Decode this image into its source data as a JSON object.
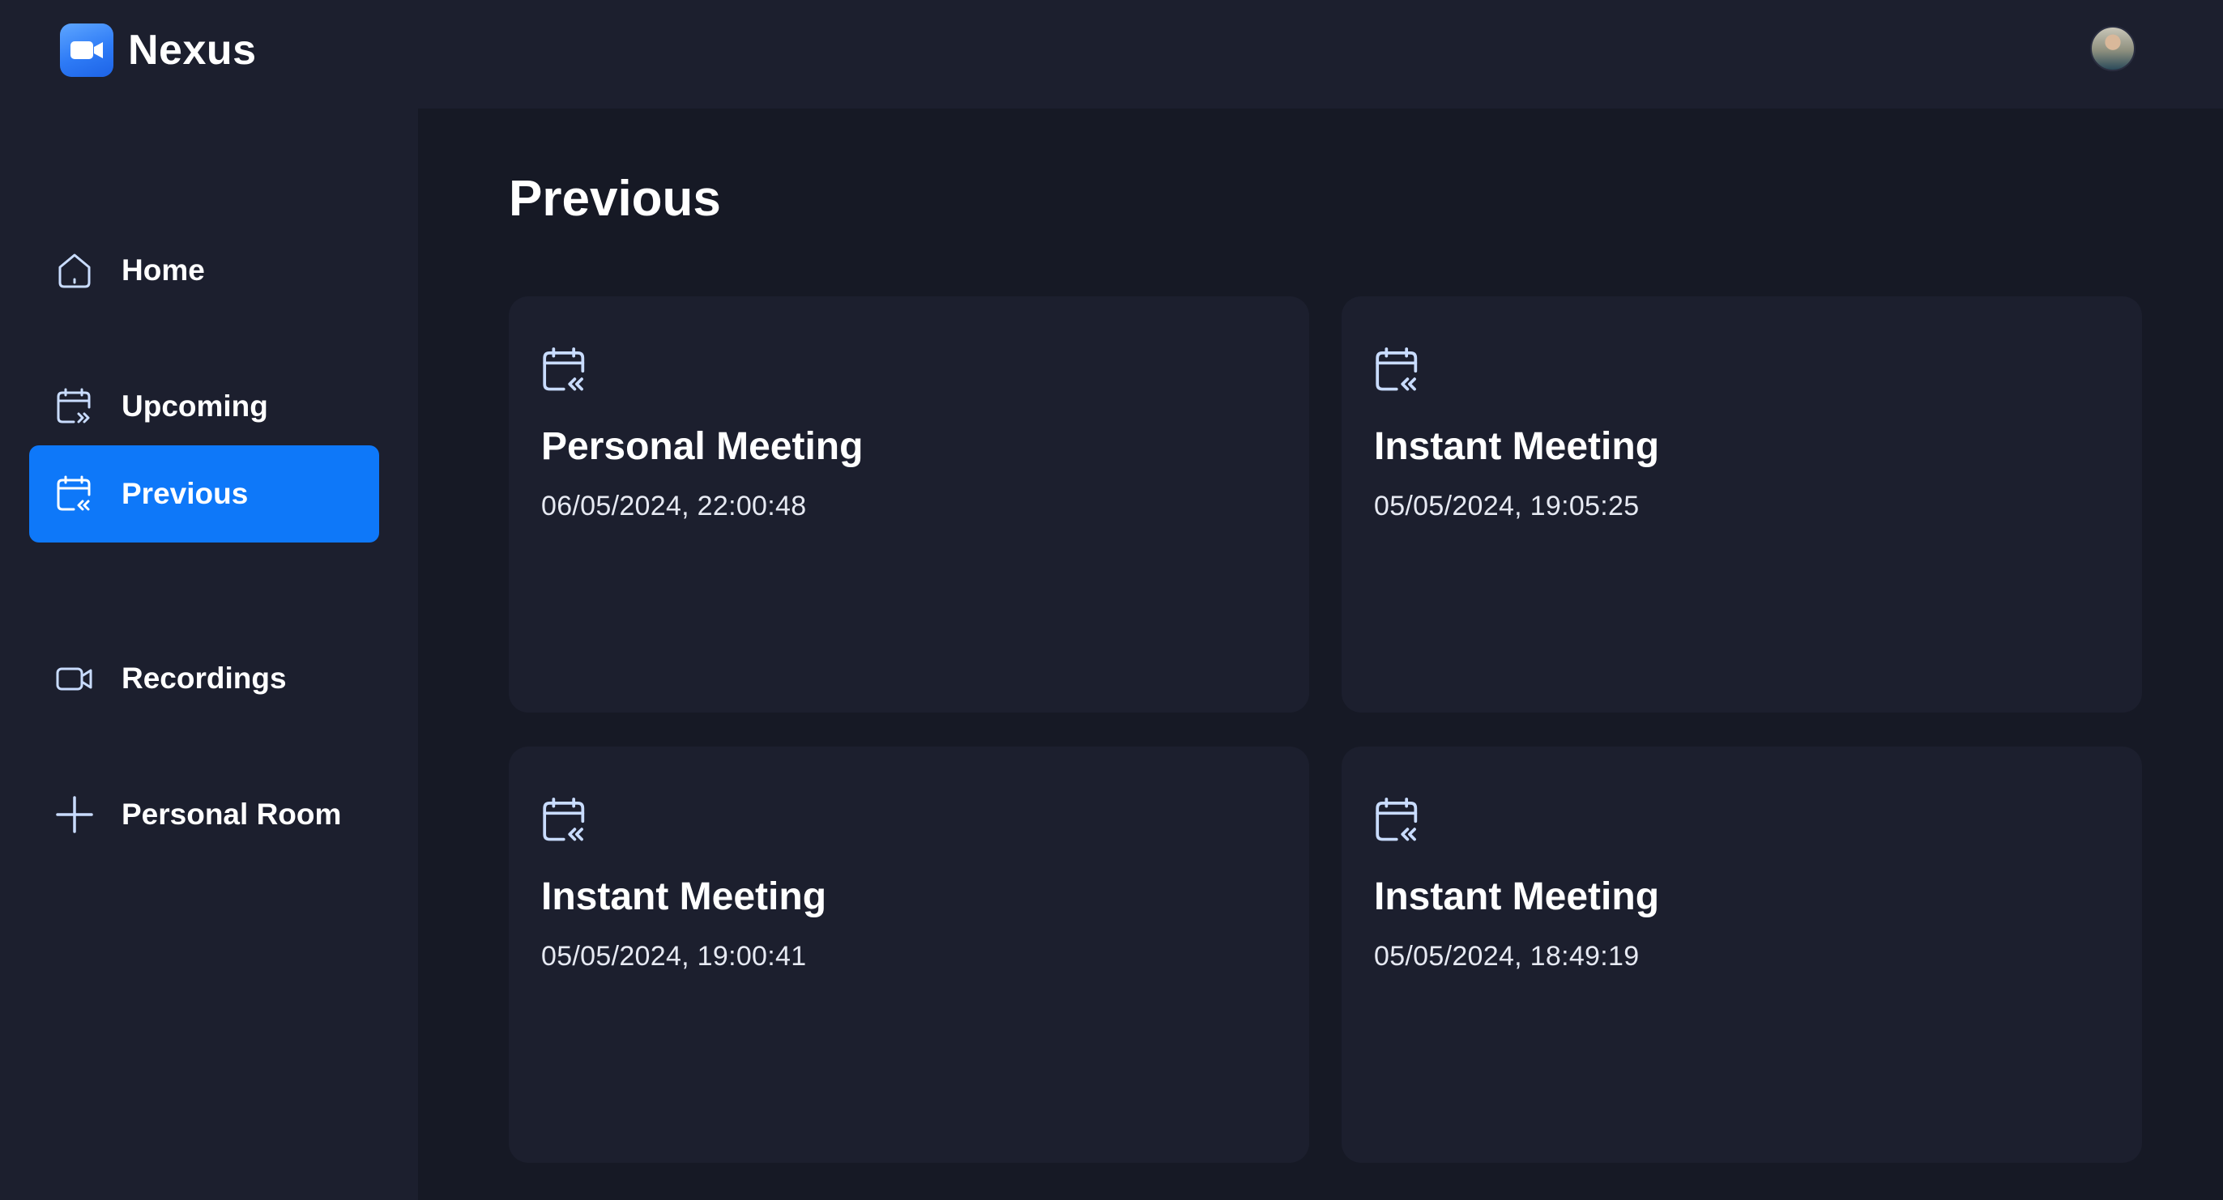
{
  "app": {
    "name": "Nexus"
  },
  "sidebar": {
    "items": [
      {
        "label": "Home",
        "icon": "home-icon",
        "active": false
      },
      {
        "label": "Upcoming",
        "icon": "calendar-forward-icon",
        "active": false
      },
      {
        "label": "Previous",
        "icon": "calendar-back-icon",
        "active": true
      },
      {
        "label": "Recordings",
        "icon": "video-icon",
        "active": false
      },
      {
        "label": "Personal Room",
        "icon": "plus-icon",
        "active": false
      }
    ]
  },
  "main": {
    "title": "Previous",
    "meetings": [
      {
        "title": "Personal Meeting",
        "date": "06/05/2024, 22:00:48",
        "icon": "calendar-back-icon"
      },
      {
        "title": "Instant Meeting",
        "date": "05/05/2024, 19:05:25",
        "icon": "calendar-back-icon"
      },
      {
        "title": "Instant Meeting",
        "date": "05/05/2024, 19:00:41",
        "icon": "calendar-back-icon"
      },
      {
        "title": "Instant Meeting",
        "date": "05/05/2024, 18:49:19",
        "icon": "calendar-back-icon"
      }
    ]
  },
  "colors": {
    "background": "#161925",
    "panel": "#1c1f2e",
    "accent": "#0e78f9",
    "icon_light": "#c9dcff"
  }
}
